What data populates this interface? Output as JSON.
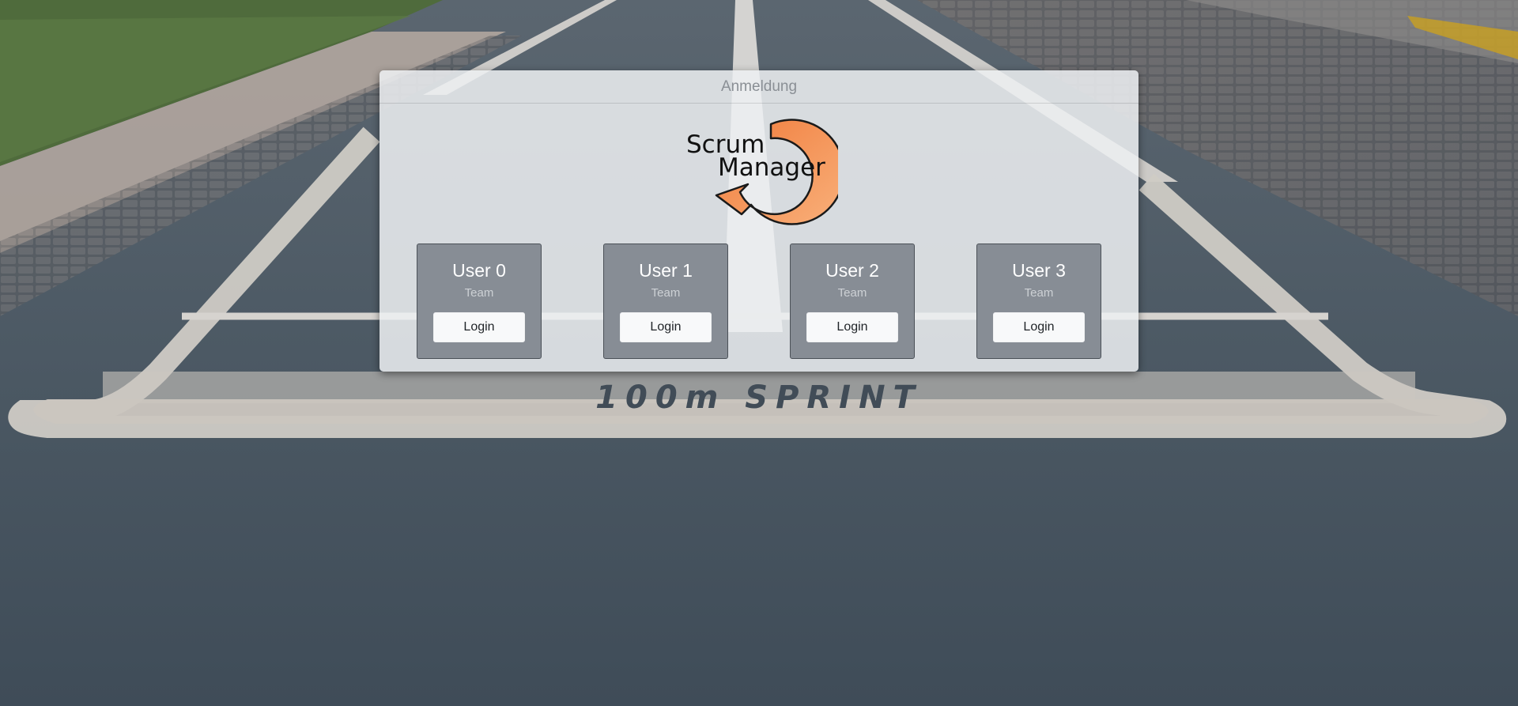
{
  "panel": {
    "title": "Anmeldung"
  },
  "logo": {
    "line1": "Scrum",
    "line2": "Manager",
    "arrow_color": "#f5914f"
  },
  "users": [
    {
      "name": "User 0",
      "role": "Team",
      "button_label": "Login"
    },
    {
      "name": "User 1",
      "role": "Team",
      "button_label": "Login"
    },
    {
      "name": "User 2",
      "role": "Team",
      "button_label": "Login"
    },
    {
      "name": "User 3",
      "role": "Team",
      "button_label": "Login"
    }
  ],
  "background": {
    "track_marking": "100m SPRINT"
  },
  "colors": {
    "card_background": "#878d95",
    "button_background": "#f8f9fa",
    "panel_title": "#8a8f95"
  }
}
